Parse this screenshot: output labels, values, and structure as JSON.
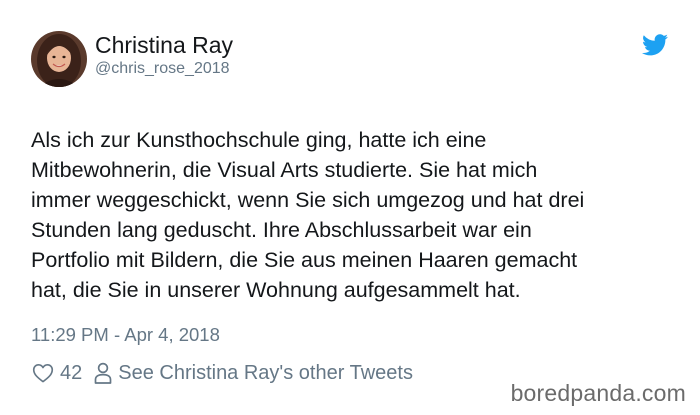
{
  "tweet": {
    "author": {
      "display_name": "Christina Ray",
      "handle": "@chris_rose_2018",
      "avatar_icon": "user-avatar-photo"
    },
    "brand_icon": "twitter-bird-icon",
    "brand_color": "#1da1f2",
    "text_lines": [
      "Als ich zur Kunsthochschule ging, hatte ich eine",
      "Mitbewohnerin, die Visual Arts studierte. Sie hat mich",
      "immer weggeschickt, wenn Sie sich umgezog und hat drei",
      "Stunden lang geduscht. Ihre Abschlussarbeit war ein",
      "Portfolio mit Bildern, die Sie aus meinen Haaren gemacht",
      "hat, die Sie in unserer Wohnung aufgesammelt hat."
    ],
    "timestamp": "11:29 PM - Apr 4, 2018",
    "likes": "42",
    "like_icon": "heart-outline-icon",
    "person_icon": "person-outline-icon",
    "other_tweets_label": "See Christina Ray's other Tweets"
  },
  "watermark": "boredpanda.com"
}
